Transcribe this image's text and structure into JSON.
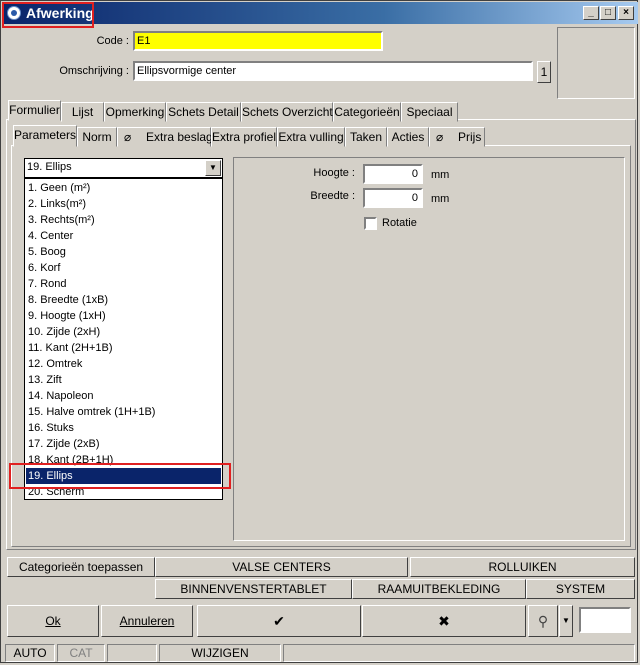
{
  "window": {
    "title": "Afwerking"
  },
  "header": {
    "code_label": "Code :",
    "code_value": "E1",
    "omschrijving_label": "Omschrijving :",
    "omschrijving_value": "Ellipsvormige center",
    "lang_button": "1"
  },
  "main_tabs": [
    "Formulier",
    "Lijst",
    "Opmerking",
    "Schets Detail",
    "Schets Overzicht",
    "Categorieën",
    "Speciaal"
  ],
  "sub_tabs": [
    "Parameters",
    "Norm",
    "Extra beslag",
    "Extra profiel",
    "Extra vulling",
    "Taken",
    "Acties",
    "Prijs"
  ],
  "dropdown": {
    "selected": "19. Ellips",
    "options": [
      "1.  Geen (m²)",
      "2.  Links(m²)",
      "3.  Rechts(m²)",
      "4.  Center",
      "5.  Boog",
      "6.  Korf",
      "7.  Rond",
      "8.  Breedte (1xB)",
      "9.  Hoogte (1xH)",
      "10. Zijde (2xH)",
      "11. Kant (2H+1B)",
      "12. Omtrek",
      "13. Zift",
      "14. Napoleon",
      "15. Halve omtrek (1H+1B)",
      "16. Stuks",
      "17. Zijde (2xB)",
      "18. Kant (2B+1H)",
      "19. Ellips",
      "20. Scherm"
    ]
  },
  "params": {
    "hoogte_label": "Hoogte :",
    "hoogte_value": "0",
    "hoogte_unit": "mm",
    "breedte_label": "Breedte :",
    "breedte_value": "0",
    "breedte_unit": "mm",
    "rotatie_label": "Rotatie"
  },
  "bottom_buttons": {
    "categorieen": "Categorieën toepassen",
    "valse_centers": "VALSE CENTERS",
    "rolluiken": "ROLLUIKEN",
    "binnenvenstertablet": "BINNENVENSTERTABLET",
    "raamuitbekleding": "RAAMUITBEKLEDING",
    "system": "SYSTEM"
  },
  "action_buttons": {
    "ok": "Ok",
    "annuleren": "Annuleren",
    "confirm": "✔",
    "cancel": "✖"
  },
  "status": {
    "auto": "AUTO",
    "cat": "CAT",
    "mode": "WIJZIGEN"
  }
}
